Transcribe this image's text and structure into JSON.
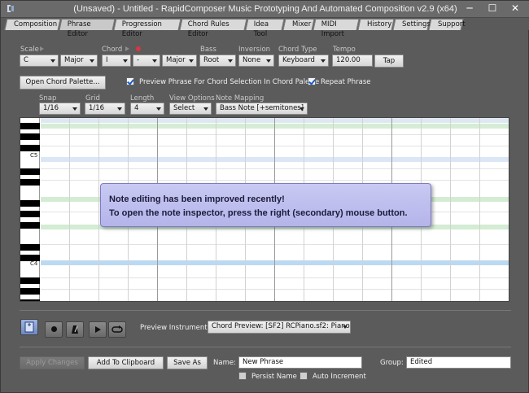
{
  "window": {
    "title": "(Unsaved) - Untitled - RapidComposer Music Prototyping And Automated Composition v2.9 (x64)",
    "minimize": "─",
    "maximize": "☐",
    "close": "✕"
  },
  "tabs": [
    "Composition",
    "Phrase Editor",
    "Progression Editor",
    "Chord Rules Editor",
    "Idea Tool",
    "Mixer",
    "MIDI Import",
    "History",
    "Settings",
    "Support"
  ],
  "active_tab": "Phrase Editor",
  "chord_bar": {
    "scale_label": "Scale",
    "scale_root": "C",
    "scale_type": "Major",
    "chord_label": "Chord",
    "chord_degree": "I",
    "chord_alter": "-",
    "chord_quality": "Major",
    "bass_label": "Bass",
    "bass_value": "Root",
    "inversion_label": "Inversion",
    "inversion_value": "None",
    "chord_type_label": "Chord Type",
    "chord_type_value": "Keyboard",
    "tempo_label": "Tempo",
    "tempo_value": "120.00",
    "tap_label": "Tap"
  },
  "options_row": {
    "open_palette_label": "Open Chord Palette...",
    "preview_phrase_label": "Preview Phrase For Chord Selection In Chord Palette",
    "preview_phrase_checked": true,
    "repeat_phrase_label": "Repeat Phrase",
    "repeat_phrase_checked": true
  },
  "grid_bar": {
    "snap_label": "Snap",
    "snap_value": "1/16",
    "grid_label": "Grid",
    "grid_value": "1/16",
    "length_label": "Length",
    "length_value": "4",
    "view_options_label": "View Options",
    "view_options_value": "Select",
    "note_mapping_label": "Note Mapping",
    "note_mapping_value": "Bass Note [+semitones]"
  },
  "piano_roll": {
    "key_labels": [
      "C5",
      "C4"
    ],
    "tooltip_line1": "Note editing has been improved recently!",
    "tooltip_line2": "To open the note inspector, press the right (secondary) mouse button."
  },
  "transport": {
    "preview_instrument_label": "Preview Instrument:",
    "preview_instrument_value": "Chord Preview: [SF2] RCPiano.sf2: Piano"
  },
  "footer": {
    "apply_changes_label": "Apply Changes",
    "add_to_clipboard_label": "Add To Clipboard",
    "save_as_label": "Save As",
    "name_label": "Name:",
    "name_value": "New Phrase",
    "group_label": "Group:",
    "group_value": "Edited",
    "persist_name_label": "Persist Name",
    "persist_name_checked": false,
    "auto_increment_label": "Auto Increment",
    "auto_increment_checked": false
  }
}
